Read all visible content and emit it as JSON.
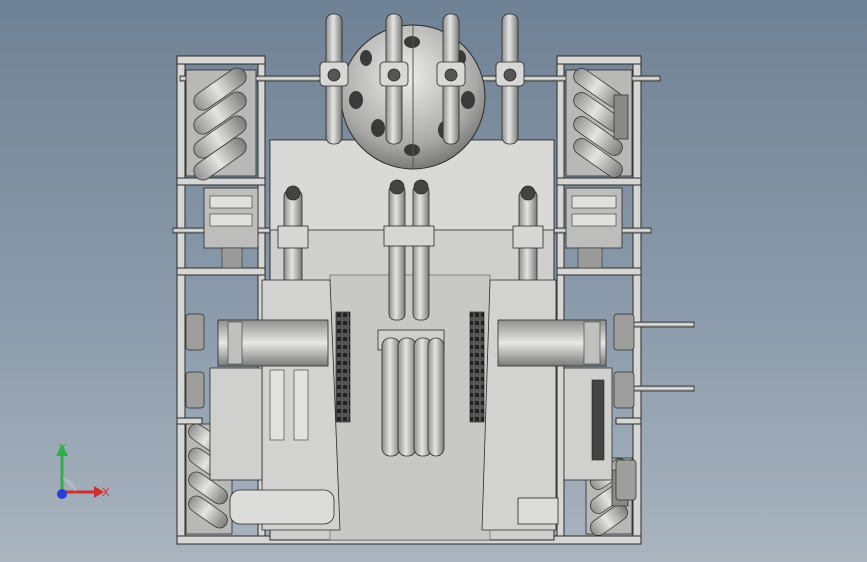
{
  "viewport": {
    "background_top": "#6f8194",
    "background_bottom": "#a9b4bf"
  },
  "model": {
    "description_icon": "robot-chassis-assembly",
    "metal_color": "#c9c9c7",
    "dark_edge_color": "#2a2a2a",
    "shadow_color": "#7b7b7a"
  },
  "triad": {
    "x_label": "X",
    "y_label": "Y",
    "x_color": "#d0302a",
    "y_color": "#2fb04a",
    "z_color": "#2b3fd6"
  }
}
